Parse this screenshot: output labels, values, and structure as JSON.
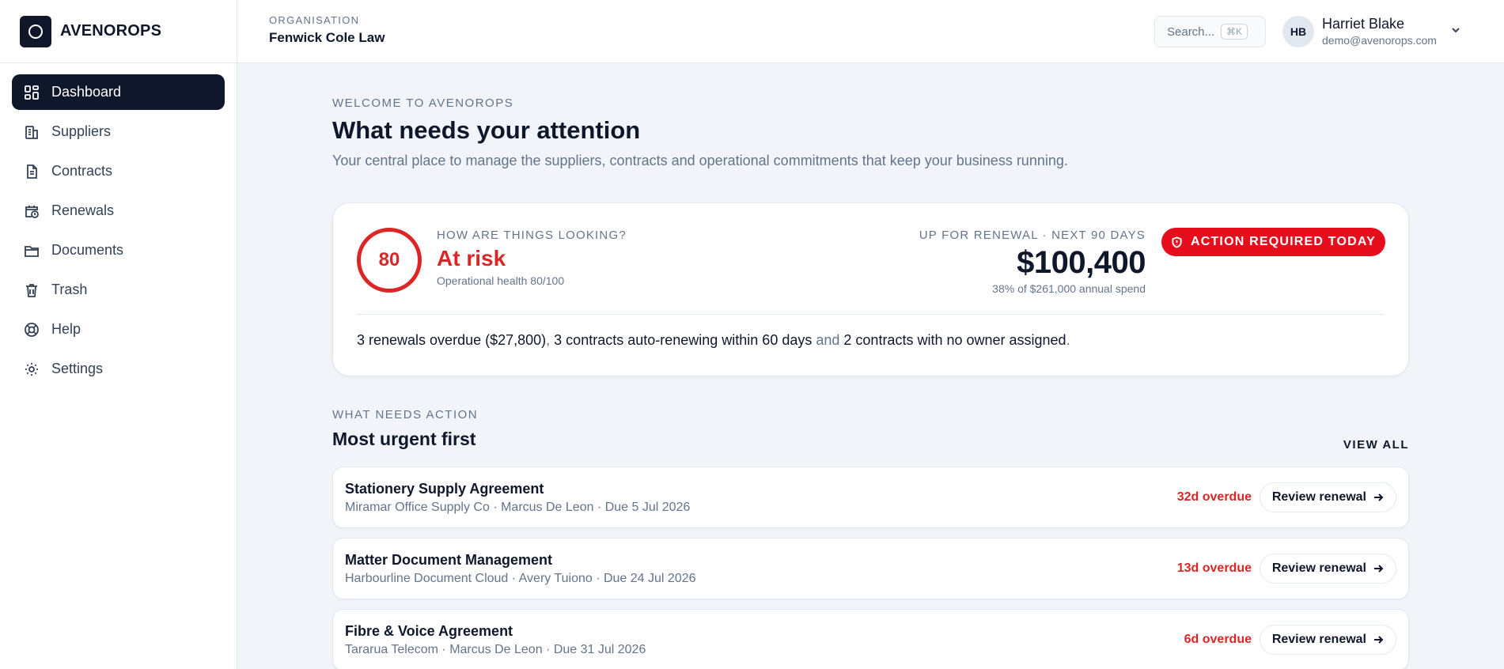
{
  "brand": {
    "name": "AVENOROPS"
  },
  "sidebar": {
    "items": [
      {
        "label": "Dashboard",
        "icon": "dashboard-icon",
        "active": true
      },
      {
        "label": "Suppliers",
        "icon": "building-icon"
      },
      {
        "label": "Contracts",
        "icon": "document-icon"
      },
      {
        "label": "Renewals",
        "icon": "calendar-clock-icon"
      },
      {
        "label": "Documents",
        "icon": "folder-icon"
      },
      {
        "label": "Trash",
        "icon": "trash-icon"
      },
      {
        "label": "Help",
        "icon": "lifebuoy-icon"
      },
      {
        "label": "Settings",
        "icon": "gear-icon"
      }
    ]
  },
  "header": {
    "org_label": "ORGANISATION",
    "org_name": "Fenwick Cole Law",
    "search_placeholder": "Search...",
    "search_shortcut": "⌘K",
    "user": {
      "initials": "HB",
      "name": "Harriet Blake",
      "email": "demo@avenorops.com"
    }
  },
  "main": {
    "eyebrow": "WELCOME TO AVENOROPS",
    "title": "What needs your attention",
    "intro": "Your central place to manage the suppliers, contracts and operational commitments that keep your business running."
  },
  "health": {
    "score": "80",
    "question": "HOW ARE THINGS LOOKING?",
    "status": "At risk",
    "subtitle": "Operational health 80/100",
    "renewal_label": "UP FOR RENEWAL · NEXT 90 DAYS",
    "renewal_amount": "$100,400",
    "renewal_sub": "38% of $261,000 annual spend",
    "badge": "ACTION REQUIRED TODAY",
    "summary_part1": "3 renewals overdue ($27,800)",
    "summary_sep1": ", ",
    "summary_part2": "3 contracts auto-renewing within 60 days",
    "summary_sep2": " and ",
    "summary_part3": "2 contracts with no owner assigned",
    "summary_end": "."
  },
  "actions": {
    "eyebrow": "WHAT NEEDS ACTION",
    "title": "Most urgent first",
    "view_all": "VIEW ALL",
    "items": [
      {
        "title": "Stationery Supply Agreement",
        "meta": "Miramar Office Supply Co · Marcus De Leon · Due 5 Jul 2026",
        "overdue": "32d overdue",
        "button": "Review renewal"
      },
      {
        "title": "Matter Document Management",
        "meta": "Harbourline Document Cloud · Avery Tuiono · Due 24 Jul 2026",
        "overdue": "13d overdue",
        "button": "Review renewal"
      },
      {
        "title": "Fibre & Voice Agreement",
        "meta": "Tararua Telecom · Marcus De Leon · Due 31 Jul 2026",
        "overdue": "6d overdue",
        "button": "Review renewal"
      }
    ]
  },
  "colors": {
    "accent": "#0f172a",
    "danger": "#dc2626",
    "badge": "#e60e1d"
  }
}
